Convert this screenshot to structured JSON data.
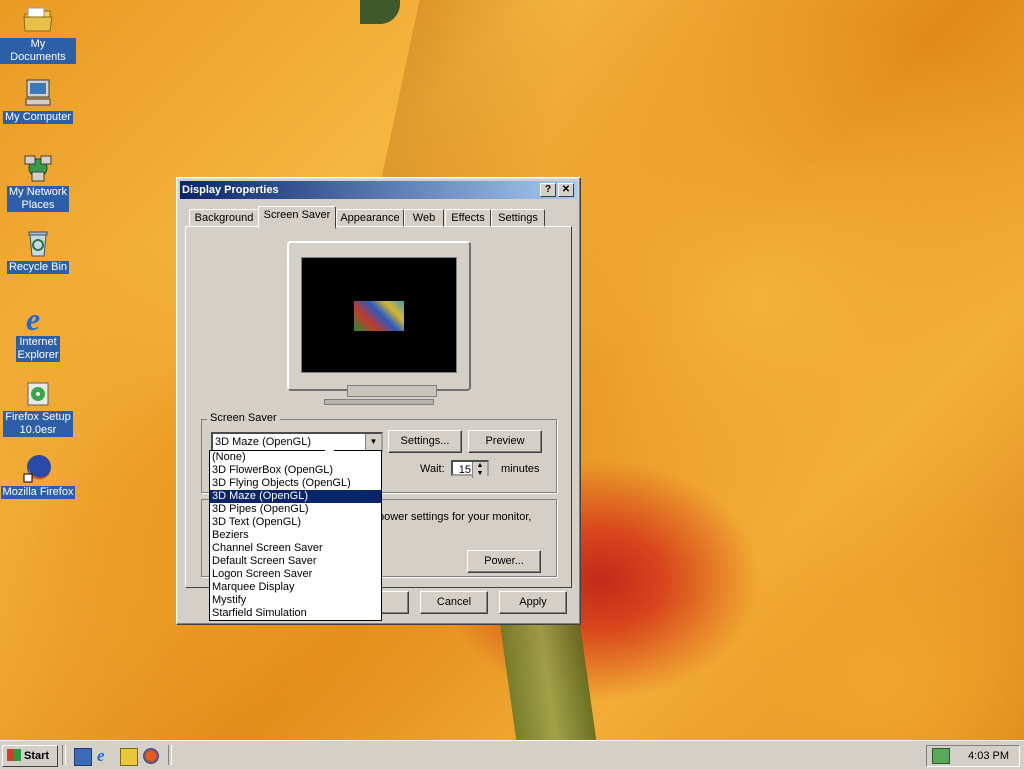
{
  "desktop": {
    "icons": [
      {
        "label": "My Documents",
        "icon": "folder-icon"
      },
      {
        "label": "My Computer",
        "icon": "computer-icon"
      },
      {
        "label_line1": "My Network",
        "label_line2": "Places",
        "icon": "network-icon"
      },
      {
        "label": "Recycle Bin",
        "icon": "recycle-bin-icon"
      },
      {
        "label_line1": "Internet",
        "label_line2": "Explorer",
        "icon": "internet-explorer-icon"
      },
      {
        "label_line1": "Firefox Setup",
        "label_line2": "10.0esr",
        "icon": "installer-icon"
      },
      {
        "label": "Mozilla Firefox",
        "icon": "firefox-icon"
      }
    ]
  },
  "dialog": {
    "title": "Display Properties",
    "help_glyph": "?",
    "close_glyph": "✕",
    "tabs": [
      "Background",
      "Screen Saver",
      "Appearance",
      "Web",
      "Effects",
      "Settings"
    ],
    "active_tab": "Screen Saver",
    "screen_saver_group_label": "Screen Saver",
    "selected_saver": "3D Maze (OpenGL)",
    "settings_label": "Settings...",
    "preview_label": "Preview",
    "wait_label": "Wait:",
    "wait_value": "15",
    "minutes_label": "minutes",
    "power_text": "power settings for your monitor,",
    "power_label": "Power...",
    "cancel_label": "Cancel",
    "apply_label": "Apply",
    "saver_options": [
      "(None)",
      "3D FlowerBox (OpenGL)",
      "3D Flying Objects (OpenGL)",
      "3D Maze (OpenGL)",
      "3D Pipes (OpenGL)",
      "3D Text (OpenGL)",
      "Beziers",
      "Channel Screen Saver",
      "Default Screen Saver",
      "Logon Screen Saver",
      "Marquee Display",
      "Mystify",
      "Starfield Simulation"
    ]
  },
  "taskbar": {
    "start_label": "Start",
    "clock": "4:03 PM",
    "quick_launch": [
      "show-desktop-icon",
      "internet-explorer-icon",
      "channels-icon",
      "firefox-icon"
    ]
  },
  "colors": {
    "title_gradient_start": "#0a246a",
    "title_gradient_end": "#a6caf0",
    "selection": "#0a246a",
    "face": "#d4d0c8"
  }
}
